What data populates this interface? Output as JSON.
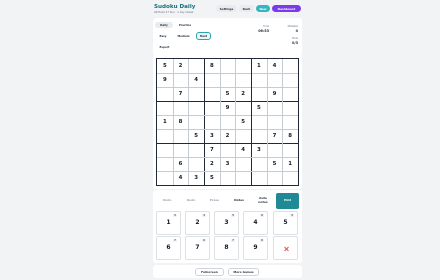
{
  "app": {
    "title": "Sudoku Daily",
    "subtitle": "2025-02-17 Sun · 1 day streak"
  },
  "topbar": {
    "settings_label": "Settings",
    "dark_label": "Dark",
    "new_label": "New",
    "dashboard_label": "Dashboard"
  },
  "mode_tabs": {
    "daily": "Daily",
    "practice": "Practice"
  },
  "difficulty": {
    "easy": "Easy",
    "medium": "Medium",
    "hard": "Hard",
    "selected": "Hard"
  },
  "export_label": "Export",
  "stats": {
    "time_label": "Time",
    "time_value": "06:53",
    "mistakes_label": "Mistakes",
    "mistakes_value": "0",
    "hints_label": "Hints",
    "hints_value": "0/3"
  },
  "board": {
    "rows": [
      [
        "5",
        "2",
        "",
        "8",
        "",
        "",
        "1",
        "4",
        ""
      ],
      [
        "9",
        "",
        "4",
        "",
        "",
        "",
        "",
        "",
        ""
      ],
      [
        "",
        "7",
        "",
        "",
        "5",
        "2",
        "",
        "9",
        ""
      ],
      [
        "",
        "",
        "",
        "",
        "9",
        "",
        "5",
        "",
        ""
      ],
      [
        "1",
        "8",
        "",
        "",
        "",
        "5",
        "",
        "",
        ""
      ],
      [
        "",
        "",
        "5",
        "3",
        "2",
        "",
        "",
        "7",
        "8"
      ],
      [
        "",
        "",
        "",
        "7",
        "",
        "4",
        "3",
        "",
        ""
      ],
      [
        "",
        "6",
        "",
        "2",
        "3",
        "",
        "",
        "5",
        "1"
      ],
      [
        "",
        "4",
        "3",
        "5",
        "",
        "",
        "",
        "",
        ""
      ]
    ]
  },
  "tools": {
    "undo": "Undo",
    "redo": "Redo",
    "erase": "Erase",
    "notes": "Notes",
    "auto_notes": "Auto notes",
    "hint": "Hint"
  },
  "keypad": {
    "keys": [
      {
        "digit": "1",
        "remaining": "5"
      },
      {
        "digit": "2",
        "remaining": "4"
      },
      {
        "digit": "3",
        "remaining": "5"
      },
      {
        "digit": "4",
        "remaining": "6"
      },
      {
        "digit": "5",
        "remaining": "3"
      },
      {
        "digit": "6",
        "remaining": "7"
      },
      {
        "digit": "7",
        "remaining": "6"
      },
      {
        "digit": "8",
        "remaining": "7"
      },
      {
        "digit": "9",
        "remaining": "6"
      }
    ],
    "clear_icon": "close-icon"
  },
  "footer": {
    "fullscreen": "Fullscreen",
    "more_games": "More Games"
  },
  "colors": {
    "accent": "#15707a",
    "hint_bg": "#1f8a96",
    "new_bg": "#36b5c0",
    "dashboard_bg": "#7c3aed",
    "hard_border": "#2aa6b0",
    "clear_red": "#e05252"
  }
}
